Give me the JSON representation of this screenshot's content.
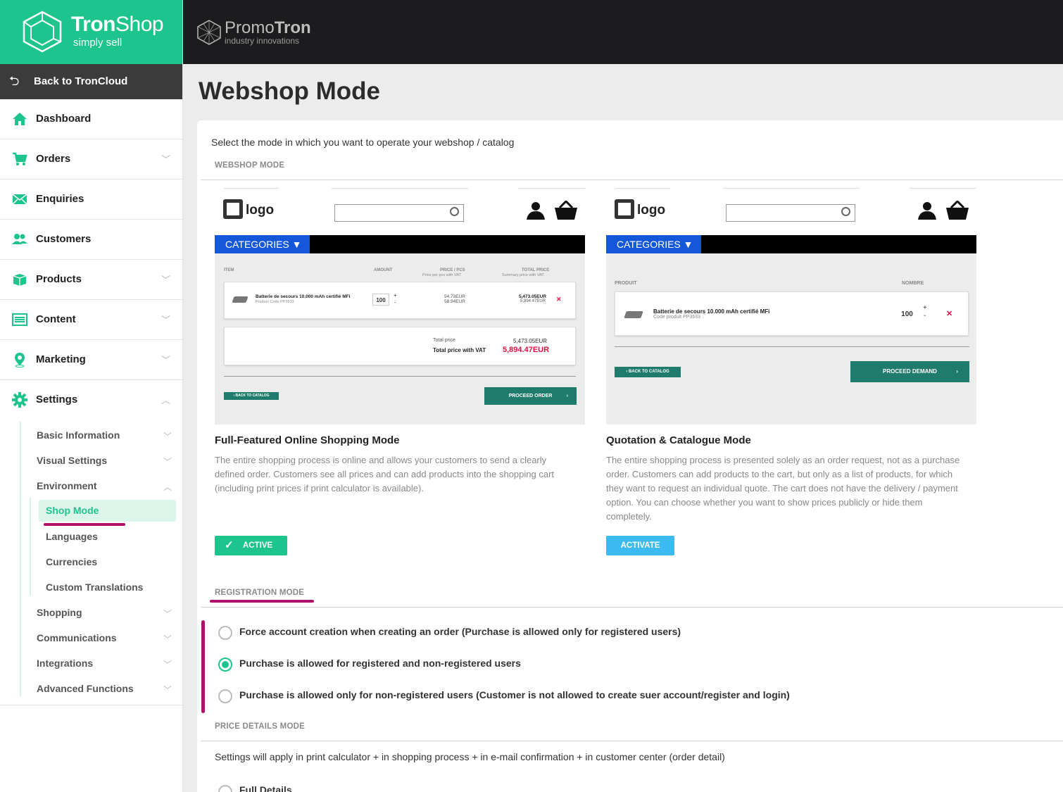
{
  "brand": {
    "name_bold": "Tron",
    "name_light": "Shop",
    "tagline": "simply sell"
  },
  "partner": {
    "name_light": "Promo",
    "name_bold": "Tron",
    "tagline": "industry innovations"
  },
  "sidebar": {
    "back_label": "Back to TronCloud",
    "items": [
      {
        "label": "Dashboard",
        "icon": "home-icon"
      },
      {
        "label": "Orders",
        "icon": "cart-icon"
      },
      {
        "label": "Enquiries",
        "icon": "mail-icon"
      },
      {
        "label": "Customers",
        "icon": "users-icon"
      },
      {
        "label": "Products",
        "icon": "box-icon"
      },
      {
        "label": "Content",
        "icon": "list-icon"
      },
      {
        "label": "Marketing",
        "icon": "pin-icon"
      },
      {
        "label": "Settings",
        "icon": "gear-icon"
      }
    ],
    "settings_sub": [
      "Basic Information",
      "Visual Settings",
      "Environment",
      "Shopping",
      "Communications",
      "Integrations",
      "Advanced Functions"
    ],
    "environment_sub": [
      "Shop Mode",
      "Languages",
      "Currencies",
      "Custom Translations"
    ]
  },
  "page": {
    "title": "Webshop Mode",
    "intro": "Select the mode in which you want to operate your webshop / catalog",
    "section_webshop": "WEBSHOP MODE",
    "section_registration": "REGISTRATION MODE",
    "section_price": "PRICE DETAILS MODE",
    "price_note": "Settings will apply in print calculator + in shopping process + in e-mail confirmation + in customer center (order detail)",
    "price_option_1": "Full Details"
  },
  "mockup": {
    "logo": "logo",
    "categories": "CATEGORIES ▼",
    "left": {
      "col_item": "ITEM",
      "col_amount": "AMOUNT",
      "col_price": "PRICE / PCS",
      "col_price_sub": "Price per pcs with VAT",
      "col_total": "TOTAL PRICE",
      "col_total_sub": "Summary price with VAT",
      "product": "Batterie de secours 10.000 mAh certifié MFi",
      "code": "Product Code PP3533",
      "qty": "100",
      "unit1": "54.73EUR",
      "unit2": "58.94EUR",
      "tot1": "5,473.05EUR",
      "tot2": "5,894.47EUR",
      "total_label": "Total price",
      "total_value": "5,473.05EUR",
      "total_vat_label": "Total price with VAT",
      "total_vat_value": "5,894.47EUR",
      "back": "‹ BACK TO CATALOG",
      "proceed": "PROCEED ORDER"
    },
    "right": {
      "col_product": "PRODUIT",
      "col_nombre": "NOMBRE",
      "product": "Batterie de secours 10.000 mAh certifié MFi",
      "code": "Code produit PP3533",
      "qty": "100",
      "back": "‹ BACK TO CATALOG",
      "proceed": "PROCEED DEMAND"
    }
  },
  "modes": [
    {
      "title": "Full-Featured Online Shopping Mode",
      "desc": "The entire shopping process is online and allows your customers to send a clearly defined order. Customers see all prices and can add products into the shopping cart (including print prices if print calculator is available).",
      "button": "ACTIVE"
    },
    {
      "title": "Quotation & Catalogue Mode",
      "desc": "The entire shopping process is presented solely as an order request, not as a purchase order. Customers can add products to the cart, but only as a list of products, for which they want to request an individual quote. The cart does not have the delivery / payment option. You can choose whether you want to show prices publicly or hide them completely.",
      "button": "ACTIVATE"
    }
  ],
  "registration": [
    {
      "label": "Force account creation when creating an order (Purchase is allowed only for registered users)",
      "selected": false
    },
    {
      "label": "Purchase is allowed for registered and non-registered users",
      "selected": true
    },
    {
      "label": "Purchase is allowed only for non-registered users (Customer is not allowed to create suer account/register and login)",
      "selected": false
    }
  ],
  "colors": {
    "brand_green": "#1ec48d",
    "annotation_magenta": "#b0126a",
    "active_button": "#1ec48d",
    "activate_button": "#3bbbef",
    "dark_teal": "#1f7b6b",
    "total_red": "#e0103f"
  }
}
